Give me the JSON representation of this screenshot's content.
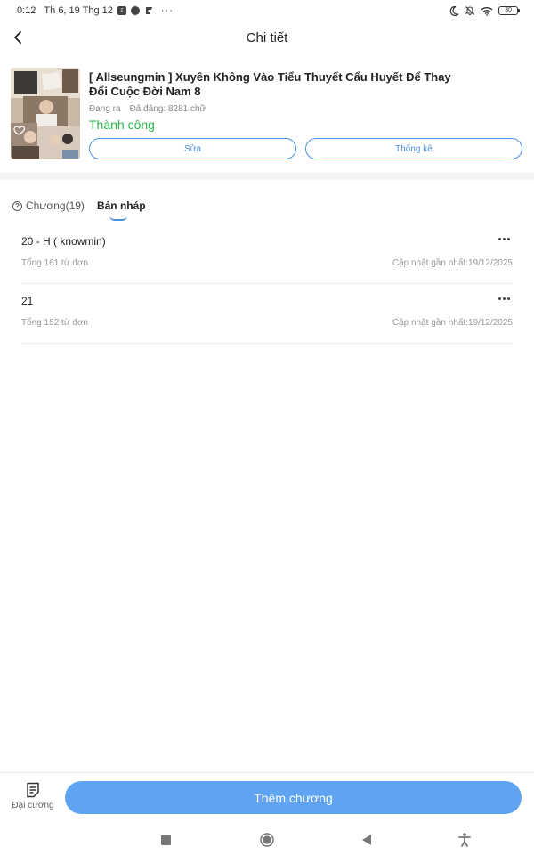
{
  "status_bar": {
    "time": "0:12",
    "date": "Th 6, 19 Thg 12",
    "notification_icons": [
      "zalo-icon",
      "messenger-icon",
      "app-icon"
    ],
    "more": "···",
    "battery": "30"
  },
  "header": {
    "title": "Chi tiết"
  },
  "book": {
    "title": "[ Allseungmin ] Xuyên Không Vào Tiểu Thuyết Cẩu Huyết Để Thay Đổi Cuộc Đời Nam 8",
    "state": "Đang ra",
    "published": "Đã đăng: 8281 chữ",
    "status": "Thành công",
    "edit_label": "Sửa",
    "stats_label": "Thống kê"
  },
  "tabs": [
    {
      "label": "Chương(19)"
    },
    {
      "label": "Bản nháp"
    }
  ],
  "chapters": [
    {
      "title": "20 - H ( knowmin)",
      "words": "Tổng 161 từ đơn",
      "updated": "Cập nhật gần nhất:19/12/2025"
    },
    {
      "title": "21",
      "words": "Tổng 152 từ đơn",
      "updated": "Cập nhật gần nhất:19/12/2025"
    }
  ],
  "bottom": {
    "outline_label": "Đại cương",
    "add_chapter_label": "Thêm chương"
  },
  "colors": {
    "accent": "#4a90e2",
    "primary_button": "#5ea4f2",
    "success": "#2cb34a"
  }
}
